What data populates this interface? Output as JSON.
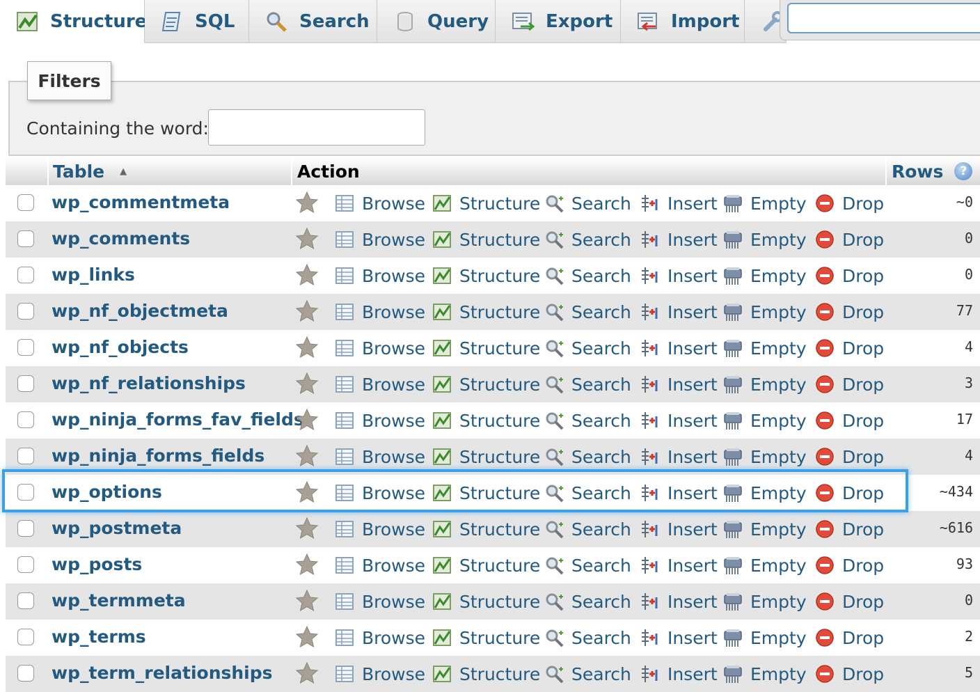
{
  "tabs": [
    {
      "label": "Structure",
      "icon": "structure-icon",
      "active": true
    },
    {
      "label": "SQL",
      "icon": "sql-icon"
    },
    {
      "label": "Search",
      "icon": "search-icon"
    },
    {
      "label": "Query",
      "icon": "query-icon"
    },
    {
      "label": "Export",
      "icon": "export-icon"
    },
    {
      "label": "Import",
      "icon": "import-icon"
    },
    {
      "label": "",
      "icon": "operations-icon"
    }
  ],
  "filters": {
    "legend": "Filters",
    "label": "Containing the word:",
    "value": ""
  },
  "table": {
    "headers": {
      "table": "Table",
      "action": "Action",
      "rows": "Rows"
    },
    "actions": [
      "Browse",
      "Structure",
      "Search",
      "Insert",
      "Empty",
      "Drop"
    ],
    "highlighted_row": "wp_options",
    "rows": [
      {
        "name": "wp_commentmeta",
        "count": "~0"
      },
      {
        "name": "wp_comments",
        "count": "0"
      },
      {
        "name": "wp_links",
        "count": "0"
      },
      {
        "name": "wp_nf_objectmeta",
        "count": "77"
      },
      {
        "name": "wp_nf_objects",
        "count": "4"
      },
      {
        "name": "wp_nf_relationships",
        "count": "3"
      },
      {
        "name": "wp_ninja_forms_fav_fields",
        "count": "17"
      },
      {
        "name": "wp_ninja_forms_fields",
        "count": "4"
      },
      {
        "name": "wp_options",
        "count": "~434"
      },
      {
        "name": "wp_postmeta",
        "count": "~616"
      },
      {
        "name": "wp_posts",
        "count": "93"
      },
      {
        "name": "wp_termmeta",
        "count": "0"
      },
      {
        "name": "wp_terms",
        "count": "2"
      },
      {
        "name": "wp_term_relationships",
        "count": "5"
      }
    ]
  },
  "colors": {
    "link": "#235a81",
    "highlight": "#3aa0ea",
    "drop": "#e04b3a"
  }
}
